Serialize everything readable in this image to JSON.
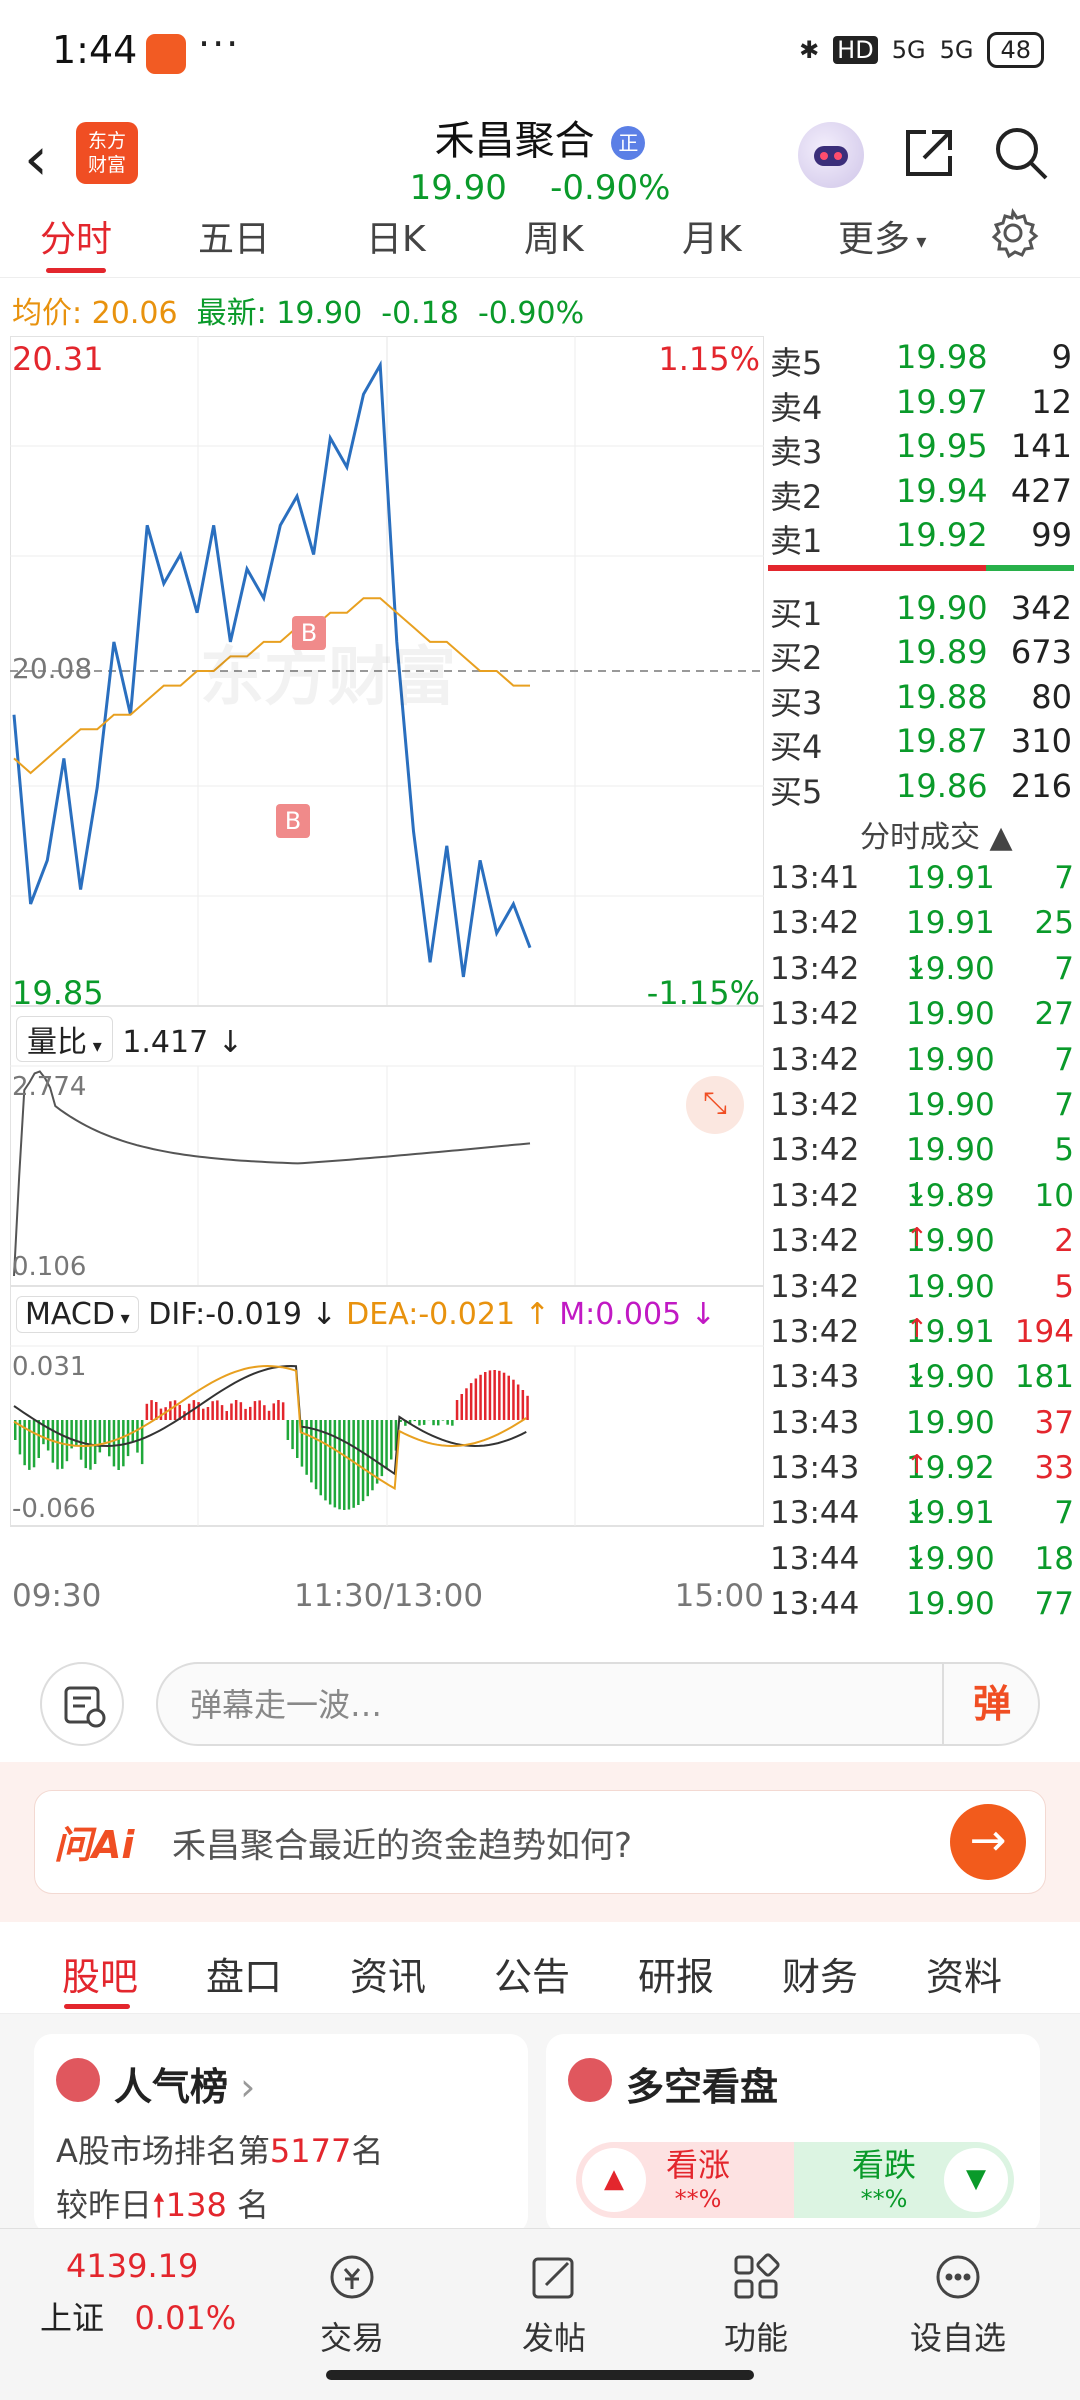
{
  "status_bar": {
    "time": "1:44",
    "dots": "···",
    "hd": "HD",
    "signal1": "5G",
    "signal2": "5G",
    "battery": "48"
  },
  "header": {
    "logo_line1": "东方",
    "logo_line2": "财富",
    "stock_name": "禾昌聚合",
    "badge": "正",
    "price": "19.90",
    "change_pct": "-0.90%"
  },
  "tabs": [
    "分时",
    "五日",
    "日K",
    "周K",
    "月K",
    "更多"
  ],
  "info_line": {
    "avg_label": "均价: ",
    "avg_value": "20.06",
    "latest_label": "最新: ",
    "latest_value": "19.90",
    "change": "-0.18",
    "change_pct": "-0.90%"
  },
  "chart_labels": {
    "top_price": "20.31",
    "top_pct": "1.15%",
    "bottom_price": "19.85",
    "bottom_pct": "-1.15%",
    "mid_price": "20.08",
    "watermark": "东方财富",
    "volume_ratio_label": "量比",
    "volume_ratio_value": "1.417 ↓",
    "vr_top": "2.774",
    "vr_bottom": "0.106",
    "macd_label": "MACD",
    "dif": "DIF:-0.019 ↓",
    "dea": "DEA:-0.021 ↑",
    "m": "M:0.005 ↓",
    "macd_top": "0.031",
    "macd_bottom": "-0.066",
    "time_start": "09:30",
    "time_mid": "11:30/13:00",
    "time_end": "15:00",
    "buy_marker": "B"
  },
  "order_book": {
    "sells": [
      {
        "label": "卖5",
        "price": "19.98",
        "vol": "9"
      },
      {
        "label": "卖4",
        "price": "19.97",
        "vol": "12"
      },
      {
        "label": "卖3",
        "price": "19.95",
        "vol": "141"
      },
      {
        "label": "卖2",
        "price": "19.94",
        "vol": "427"
      },
      {
        "label": "卖1",
        "price": "19.92",
        "vol": "99"
      }
    ],
    "buys": [
      {
        "label": "买1",
        "price": "19.90",
        "vol": "342"
      },
      {
        "label": "买2",
        "price": "19.89",
        "vol": "673"
      },
      {
        "label": "买3",
        "price": "19.88",
        "vol": "80"
      },
      {
        "label": "买4",
        "price": "19.87",
        "vol": "310"
      },
      {
        "label": "买5",
        "price": "19.86",
        "vol": "216"
      }
    ]
  },
  "trades_header": "分时成交 ▲",
  "trades": [
    {
      "time": "13:41",
      "price": "19.91",
      "arrow": "",
      "vol": "7",
      "side": "green"
    },
    {
      "time": "13:42",
      "price": "19.91",
      "arrow": "",
      "vol": "25",
      "side": "green"
    },
    {
      "time": "13:42",
      "price": "19.90",
      "arrow": "↓",
      "vol": "7",
      "side": "green"
    },
    {
      "time": "13:42",
      "price": "19.90",
      "arrow": "",
      "vol": "27",
      "side": "green"
    },
    {
      "time": "13:42",
      "price": "19.90",
      "arrow": "",
      "vol": "7",
      "side": "green"
    },
    {
      "time": "13:42",
      "price": "19.90",
      "arrow": "",
      "vol": "7",
      "side": "green"
    },
    {
      "time": "13:42",
      "price": "19.90",
      "arrow": "",
      "vol": "5",
      "side": "green"
    },
    {
      "time": "13:42",
      "price": "19.89",
      "arrow": "↓",
      "vol": "10",
      "side": "green"
    },
    {
      "time": "13:42",
      "price": "19.90",
      "arrow": "↑",
      "vol": "2",
      "side": "red"
    },
    {
      "time": "13:42",
      "price": "19.90",
      "arrow": "",
      "vol": "5",
      "side": "red"
    },
    {
      "time": "13:42",
      "price": "19.91",
      "arrow": "↑",
      "vol": "194",
      "side": "red"
    },
    {
      "time": "13:43",
      "price": "19.90",
      "arrow": "↓",
      "vol": "181",
      "side": "green"
    },
    {
      "time": "13:43",
      "price": "19.90",
      "arrow": "",
      "vol": "37",
      "side": "red"
    },
    {
      "time": "13:43",
      "price": "19.92",
      "arrow": "↑",
      "vol": "33",
      "side": "red"
    },
    {
      "time": "13:44",
      "price": "19.91",
      "arrow": "↓",
      "vol": "7",
      "side": "green"
    },
    {
      "time": "13:44",
      "price": "19.90",
      "arrow": "↓",
      "vol": "18",
      "side": "green"
    },
    {
      "time": "13:44",
      "price": "19.90",
      "arrow": "",
      "vol": "77",
      "side": "green"
    }
  ],
  "danmaku": {
    "placeholder": "弹幕走一波…",
    "button": "弹"
  },
  "ai": {
    "logo": "问Ai",
    "question": "禾昌聚合最近的资金趋势如何?"
  },
  "section_tabs": [
    "股吧",
    "盘口",
    "资讯",
    "公告",
    "研报",
    "财务",
    "资料"
  ],
  "popularity_card": {
    "title": "人气榜",
    "line1_prefix": "A股市场排名第",
    "rank": "5177",
    "line1_suffix": "名",
    "line2_prefix": "较昨日",
    "change": "138",
    "line2_suffix": "名"
  },
  "sentiment_card": {
    "title": "多空看盘",
    "bull": "看涨",
    "bull_pct": "**%",
    "bear": "看跌",
    "bear_pct": "**%"
  },
  "bottom_nav": {
    "index_value": "4139.19",
    "index_name": "上证",
    "index_change": "0.01%",
    "items": [
      "交易",
      "发帖",
      "功能",
      "设自选"
    ]
  },
  "colors": {
    "up": "#e3262d",
    "down": "#0a9a2a",
    "brand": "#f04e23",
    "price_line": "#2a6fbf",
    "avg_line": "#e8a020"
  },
  "chart_data": {
    "type": "line",
    "title": "",
    "ylim": [
      19.85,
      20.31
    ],
    "prev_close": 20.08,
    "series": [
      {
        "values": [
          20.05,
          19.92,
          19.95,
          20.02,
          19.93,
          20.0,
          20.1,
          20.05,
          20.18,
          20.14,
          20.16,
          20.12,
          20.18,
          20.1,
          20.15,
          20.13,
          20.18,
          20.2,
          20.16,
          20.24,
          20.22,
          20.27,
          20.29,
          20.1,
          19.97,
          19.88,
          19.96,
          19.87,
          19.95,
          19.9,
          19.92,
          19.89
        ]
      },
      {
        "values": [
          20.02,
          20.01,
          20.02,
          20.03,
          20.04,
          20.04,
          20.05,
          20.05,
          20.06,
          20.07,
          20.07,
          20.08,
          20.08,
          20.09,
          20.09,
          20.1,
          20.1,
          20.11,
          20.11,
          20.12,
          20.12,
          20.13,
          20.13,
          20.12,
          20.11,
          20.1,
          20.1,
          20.09,
          20.08,
          20.08,
          20.07,
          20.07
        ]
      }
    ]
  }
}
